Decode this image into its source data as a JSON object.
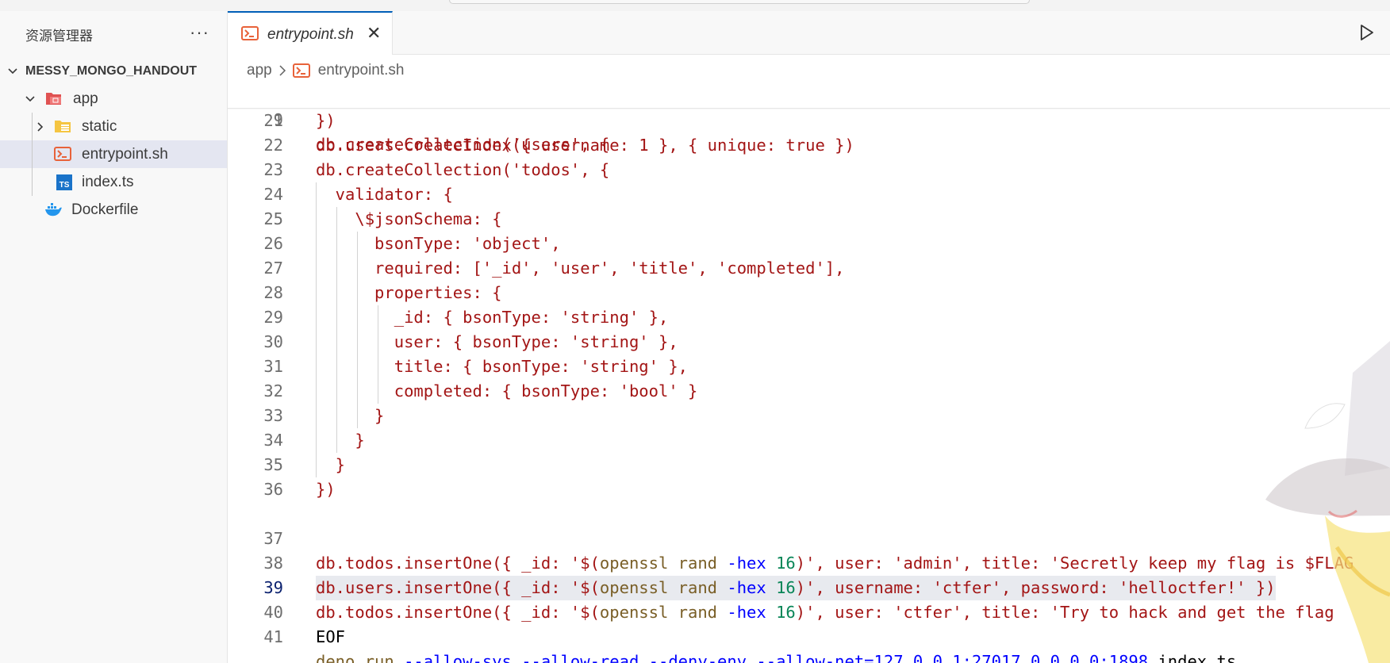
{
  "sidebar": {
    "title": "资源管理器",
    "more": "···",
    "root": "MESSY_MONGO_HANDOUT",
    "items": [
      {
        "label": "app",
        "icon": "folder-open-icon"
      },
      {
        "label": "static",
        "icon": "folder-icon"
      },
      {
        "label": "entrypoint.sh",
        "icon": "shell-file-icon"
      },
      {
        "label": "index.ts",
        "icon": "ts-file-icon"
      },
      {
        "label": "Dockerfile",
        "icon": "docker-icon"
      }
    ]
  },
  "editor": {
    "tab_label": "entrypoint.sh",
    "tab_close": "✕",
    "breadcrumb": [
      "app",
      "entrypoint.sh"
    ],
    "sticky": {
      "num": "9",
      "text": "db.createCollection('users', {"
    },
    "lines": [
      {
        "num": "21",
        "text": "})"
      },
      {
        "num": "22",
        "text": "db.users.createIndex({ username: 1 }, { unique: true })"
      },
      {
        "num": "23",
        "text": "db.createCollection('todos', {"
      },
      {
        "num": "24",
        "text": "  validator: {"
      },
      {
        "num": "25",
        "text": "    \\$jsonSchema: {"
      },
      {
        "num": "26",
        "text": "      bsonType: 'object',"
      },
      {
        "num": "27",
        "text": "      required: ['_id', 'user', 'title', 'completed'],"
      },
      {
        "num": "28",
        "text": "      properties: {"
      },
      {
        "num": "29",
        "text": "        _id: { bsonType: 'string' },"
      },
      {
        "num": "30",
        "text": "        user: { bsonType: 'string' },"
      },
      {
        "num": "31",
        "text": "        title: { bsonType: 'string' },"
      },
      {
        "num": "32",
        "text": "        completed: { bsonType: 'bool' }"
      },
      {
        "num": "33",
        "text": "      }"
      },
      {
        "num": "34",
        "text": "    }"
      },
      {
        "num": "35",
        "text": "  }"
      },
      {
        "num": "36",
        "text": "})"
      }
    ],
    "line37": {
      "num": "37",
      "a": "db.todos.insertOne({ _id: '$(",
      "b": "openssl rand ",
      "c": "-hex ",
      "d": "16",
      "e": ")', user: 'admin', title: 'Secretly keep my flag is $FLAG"
    },
    "line38": {
      "num": "38",
      "a": "db.users.insertOne({ _id: '$(",
      "b": "openssl rand ",
      "c": "-hex ",
      "d": "16",
      "e": ")', username: 'ctfer', password: 'helloctfer!' })"
    },
    "line39": {
      "num": "39",
      "a": "db.todos.insertOne({ _id: '$(",
      "b": "openssl rand ",
      "c": "-hex ",
      "d": "16",
      "e": ")', user: 'ctfer', title: 'Try to hack and get the flag"
    },
    "line40": {
      "num": "40",
      "text": "EOF"
    },
    "line41": {
      "num": "41",
      "a": "deno run ",
      "b": "--allow-sys --allow-read --deny-env --allow-net=127.0.0.1:27017,0.0.0.0:1898",
      "c": " index.ts"
    }
  }
}
